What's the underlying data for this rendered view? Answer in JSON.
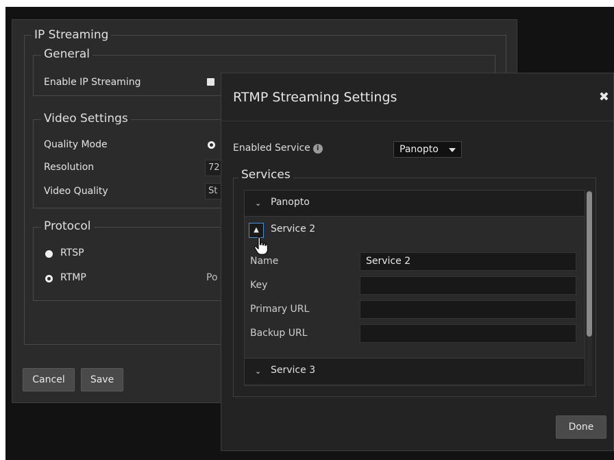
{
  "background_panel": {
    "title": "IP Streaming",
    "general": {
      "legend": "General",
      "enable_label": "Enable IP Streaming"
    },
    "video_settings": {
      "legend": "Video Settings",
      "quality_mode_label": "Quality Mode",
      "resolution_label": "Resolution",
      "resolution_value": "72",
      "video_quality_label": "Video Quality",
      "video_quality_value": "St"
    },
    "protocol": {
      "legend": "Protocol",
      "options": [
        "RTSP",
        "RTMP"
      ],
      "port_label": "Po"
    },
    "buttons": {
      "cancel": "Cancel",
      "save": "Save"
    }
  },
  "modal": {
    "title": "RTMP Streaming Settings",
    "close_glyph": "✖",
    "enabled_service_label": "Enabled Service",
    "info_glyph": "i",
    "enabled_service_value": "Panopto",
    "services_legend": "Services",
    "services": [
      {
        "name": "Panopto",
        "expanded": false,
        "chevron": "⌄"
      },
      {
        "name": "Service 2",
        "expanded": true,
        "chevron": "^"
      },
      {
        "name": "Service 3",
        "expanded": false,
        "chevron": "⌄"
      }
    ],
    "service2_fields": {
      "name_label": "Name",
      "name_value": "Service 2",
      "key_label": "Key",
      "key_value": "",
      "primary_url_label": "Primary URL",
      "primary_url_value": "",
      "backup_url_label": "Backup URL",
      "backup_url_value": ""
    },
    "done": "Done"
  },
  "colors": {
    "backdrop": "#121212",
    "panel": "#2b2b2b",
    "modal": "#232323",
    "focus_border": "#4d8fe0"
  }
}
